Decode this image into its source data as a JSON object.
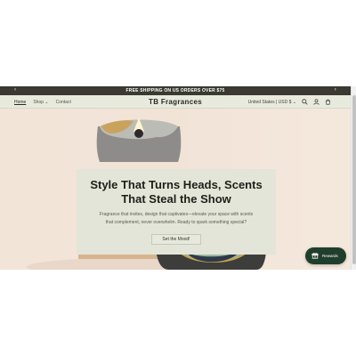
{
  "announcement": {
    "text": "FREE SHIPPING ON US ORDERS OVER $75",
    "prev": "‹",
    "next": "›"
  },
  "header": {
    "brand": "TB Fragrances",
    "nav": [
      {
        "label": "Home"
      },
      {
        "label": "Shop"
      },
      {
        "label": "Contact"
      }
    ],
    "locale": "United States | USD $"
  },
  "hero": {
    "headline_line1": "Style That Turns Heads, Scents",
    "headline_line2": "That Steal the Show",
    "subtext_line1": "Fragrance that invites, design that captivates—elevate your space with scents",
    "subtext_line2": "that complement, never overwhelm. Ready to spark something special?",
    "cta": "Set the Mood!"
  },
  "rewards": {
    "label": "Rewards"
  },
  "colors": {
    "announcement_bg": "#3a3a32",
    "header_bg": "#e8eade",
    "hero_bg": "#f3e4d8",
    "panel_bg": "#e3e5d8",
    "rewards_bg": "#1f3e2c"
  }
}
